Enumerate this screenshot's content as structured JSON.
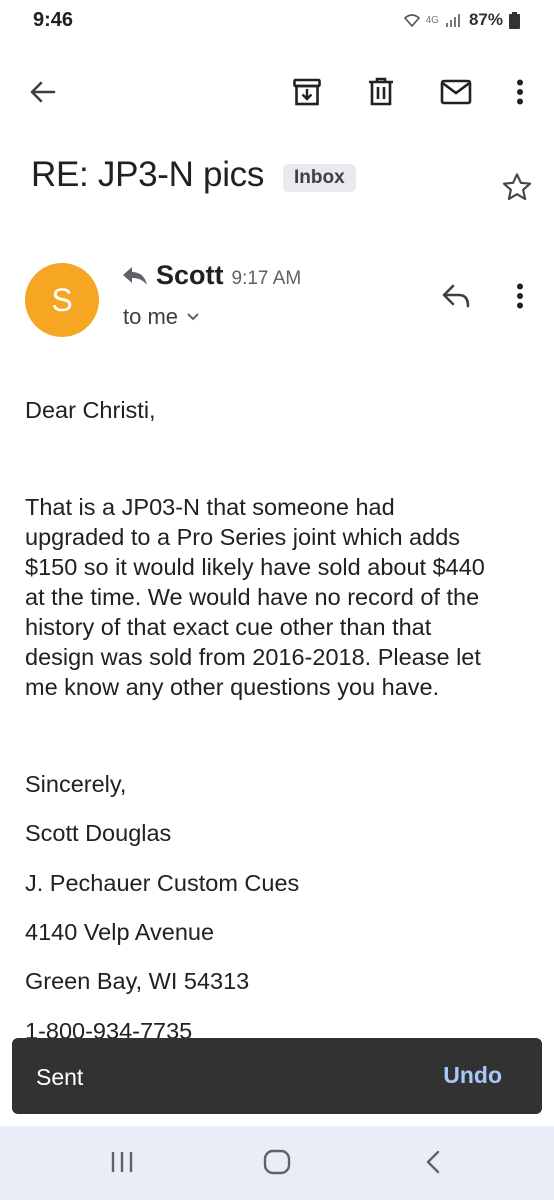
{
  "status_bar": {
    "time": "9:46",
    "network": "4G",
    "battery": "87%"
  },
  "toolbar": {
    "icons": [
      "back-arrow-icon",
      "archive-icon",
      "delete-icon",
      "mail-icon",
      "more-vert-icon"
    ]
  },
  "email": {
    "subject": "RE: JP3-N pics",
    "label": "Inbox",
    "sender": {
      "initial": "S",
      "name": "Scott",
      "time": "9:17 AM",
      "recipient": "to me",
      "avatar_color": "#f6a623"
    },
    "body": {
      "greeting": "Dear Christi,",
      "paragraph_lines": [
        "That is a JP03-N that someone had",
        "upgraded to a Pro Series joint which adds",
        "$150 so it would likely have sold about $440",
        "at the time.  We would have no record of the",
        "history of that exact cue other than that",
        "design was sold from 2016-2018.  Please let",
        "me know any other questions you have."
      ],
      "signature": [
        "Sincerely,",
        "Scott Douglas",
        "J. Pechauer Custom Cues",
        "4140 Velp Avenue",
        "Green Bay, WI  54313",
        "1-800-934-7735"
      ]
    }
  },
  "snackbar": {
    "message": "Sent",
    "action": "Undo"
  },
  "nav_bar": {
    "icons": [
      "recent-apps-icon",
      "home-icon",
      "back-icon"
    ]
  }
}
